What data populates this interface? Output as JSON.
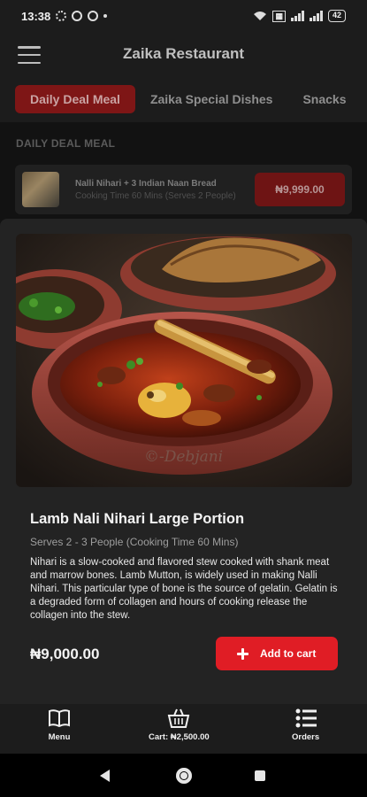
{
  "status_bar": {
    "time": "13:38",
    "battery": "42",
    "left_icons": [
      "gear-icon",
      "whatsapp-icon",
      "whatsapp-icon",
      "dot-icon"
    ],
    "right_icons": [
      "wifi-icon",
      "hd-icon",
      "signal-icon",
      "signal-icon",
      "battery-icon"
    ]
  },
  "header": {
    "title": "Zaika Restaurant",
    "menu_icon": "hamburger-icon"
  },
  "tabs": [
    {
      "label": "Daily Deal Meal",
      "active": true
    },
    {
      "label": "Zaika Special Dishes",
      "active": false
    },
    {
      "label": "Snacks",
      "active": false
    }
  ],
  "section": {
    "label": "DAILY DEAL MEAL"
  },
  "deal": {
    "name": "Nalli Nihari + 3 Indian Naan Bread",
    "meta": "Cooking Time 60 Mins (Serves 2 People)",
    "price": "₦9,999.00"
  },
  "dish": {
    "watermark": "©-Debjani",
    "title": "Lamb Nali Nihari Large Portion",
    "serves": "Serves 2 - 3 People (Cooking Time 60 Mins)",
    "description": "Nihari is a slow-cooked and flavored stew cooked with shank meat and marrow bones. Lamb Mutton, is widely used in making Nalli Nihari. This particular type of bone is the source of gelatin. Gelatin is a degraded form of collagen and hours of cooking release the collagen into the stew.",
    "price": "₦9,000.00",
    "add_label": "Add to cart"
  },
  "bottom_nav": {
    "menu_label": "Menu",
    "cart_label": "Cart: ₦2,500.00",
    "orders_label": "Orders"
  },
  "colors": {
    "accent": "#e01d25",
    "background": "#121212",
    "surface": "#232323"
  }
}
